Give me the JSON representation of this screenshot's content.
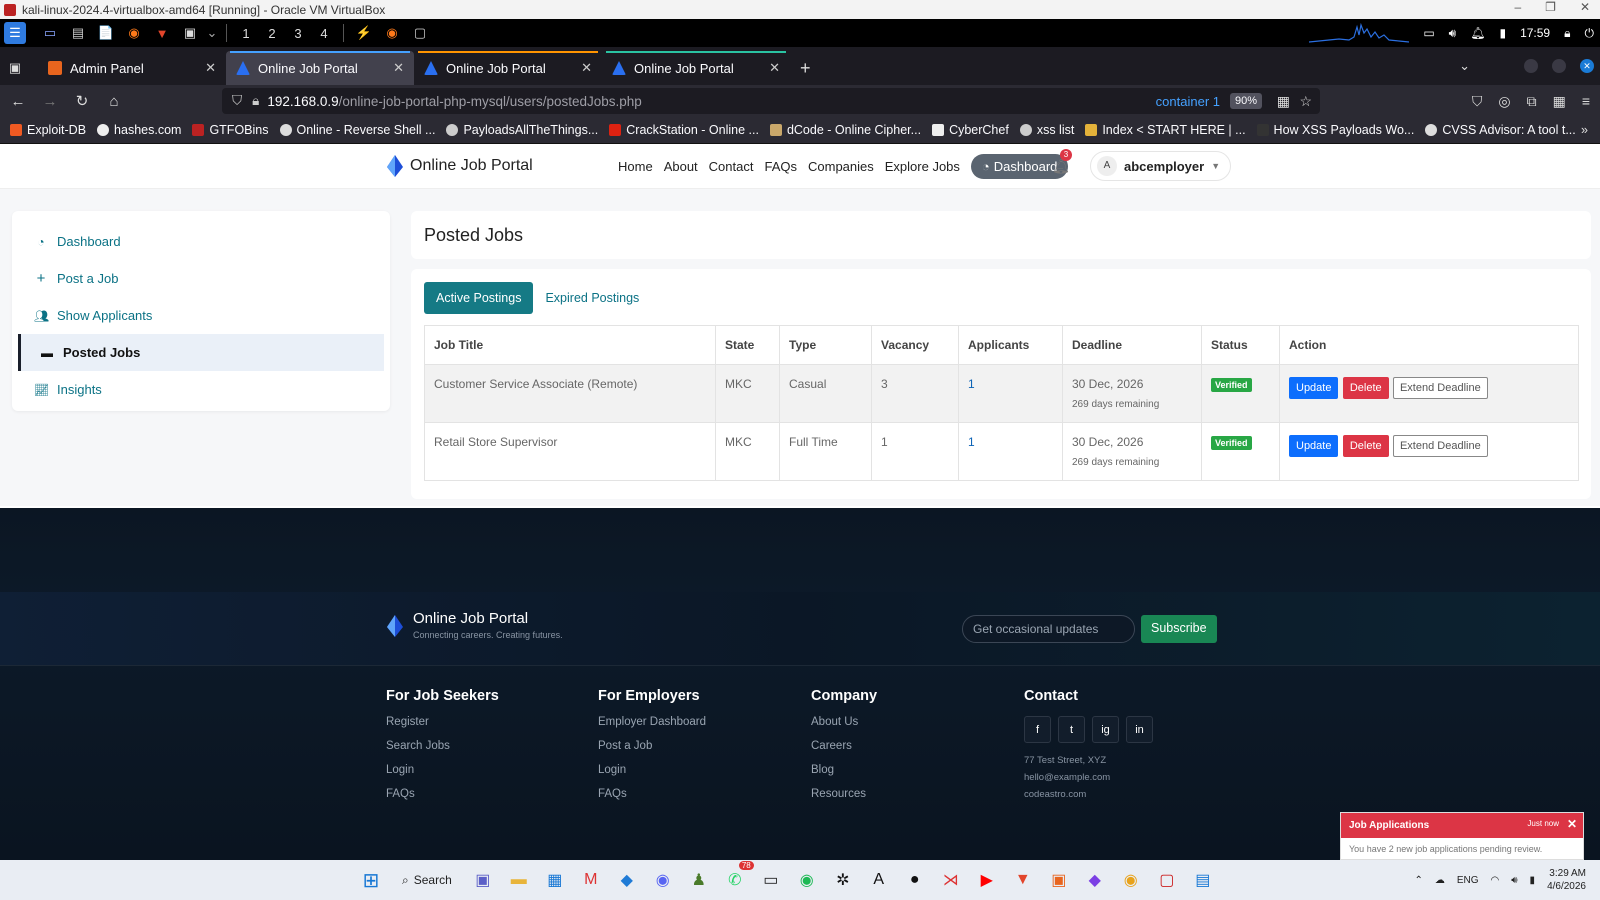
{
  "vbox": {
    "title": "kali-linux-2024.4-virtualbox-amd64 [Running] - Oracle VM VirtualBox"
  },
  "kali": {
    "workspaces": [
      "1",
      "2",
      "3",
      "4"
    ],
    "time": "17:59"
  },
  "browser": {
    "tabs": [
      {
        "label": "Admin Panel",
        "color": "#e8651e"
      },
      {
        "label": "Online Job Portal",
        "color": "#2a6ff0"
      },
      {
        "label": "Online Job Portal",
        "color": "#2a6ff0"
      },
      {
        "label": "Online Job Portal",
        "color": "#2a6ff0"
      }
    ],
    "url_host": "192.168.0.9",
    "url_path": "/online-job-portal-php-mysql/users/postedJobs.php",
    "container": "container 1",
    "zoom": "90%",
    "bookmarks": [
      "Exploit-DB",
      "hashes.com",
      "GTFOBins",
      "Online - Reverse Shell ...",
      "PayloadsAllTheThings...",
      "CrackStation - Online ...",
      "dCode - Online Cipher...",
      "CyberChef",
      "xss list",
      "Index < START HERE | ...",
      "How XSS Payloads Wo...",
      "CVSS Advisor: A tool t..."
    ]
  },
  "site": {
    "brand": "Online Job Portal",
    "menu": [
      "Home",
      "About",
      "Contact",
      "FAQs",
      "Companies",
      "Explore Jobs"
    ],
    "dashboard_btn": "Dashboard",
    "notif_count": "3",
    "user_initial": "A",
    "username": "abcemployer"
  },
  "sidebar": {
    "items": [
      {
        "label": "Dashboard",
        "icon": "gauge-icon"
      },
      {
        "label": "Post a Job",
        "icon": "plus-icon"
      },
      {
        "label": "Show Applicants",
        "icon": "users-icon"
      },
      {
        "label": "Posted Jobs",
        "icon": "briefcase-icon"
      },
      {
        "label": "Insights",
        "icon": "chart-icon"
      }
    ]
  },
  "content": {
    "title": "Posted Jobs",
    "tabs": [
      "Active Postings",
      "Expired Postings"
    ],
    "columns": [
      "Job Title",
      "State",
      "Type",
      "Vacancy",
      "Applicants",
      "Deadline",
      "Status",
      "Action"
    ],
    "rows": [
      {
        "title": "Customer Service Associate (Remote)",
        "state": "MKC",
        "type": "Casual",
        "vacancy": "3",
        "applicants": "1",
        "deadline": "30 Dec, 2026",
        "remaining": "269 days remaining",
        "status": "Verified"
      },
      {
        "title": "Retail Store Supervisor",
        "state": "MKC",
        "type": "Full Time",
        "vacancy": "1",
        "applicants": "1",
        "deadline": "30 Dec, 2026",
        "remaining": "269 days remaining",
        "status": "Verified"
      }
    ],
    "actions": {
      "update": "Update",
      "delete": "Delete",
      "extend": "Extend Deadline"
    }
  },
  "footer": {
    "brand": "Online Job Portal",
    "tagline": "Connecting careers. Creating futures.",
    "newsletter_placeholder": "Get occasional updates",
    "subscribe": "Subscribe",
    "columns": [
      {
        "heading": "For Job Seekers",
        "links": [
          "Register",
          "Search Jobs",
          "Login",
          "FAQs"
        ]
      },
      {
        "heading": "For Employers",
        "links": [
          "Employer Dashboard",
          "Post a Job",
          "Login",
          "FAQs"
        ]
      },
      {
        "heading": "Company",
        "links": [
          "About Us",
          "Careers",
          "Blog",
          "Resources"
        ]
      }
    ],
    "contact": {
      "heading": "Contact",
      "social": [
        "f",
        "t",
        "ig",
        "in"
      ],
      "address": "77 Test Street, XYZ",
      "email": "hello@example.com",
      "site": "codeastro.com"
    }
  },
  "toast": {
    "title": "Job Applications",
    "time": "Just now",
    "body": "You have 2 new job applications pending review."
  },
  "taskbar": {
    "search": "Search",
    "whatsapp_badge": "78",
    "lang": "ENG",
    "time": "3:29 AM",
    "date": "4/6/2026"
  }
}
